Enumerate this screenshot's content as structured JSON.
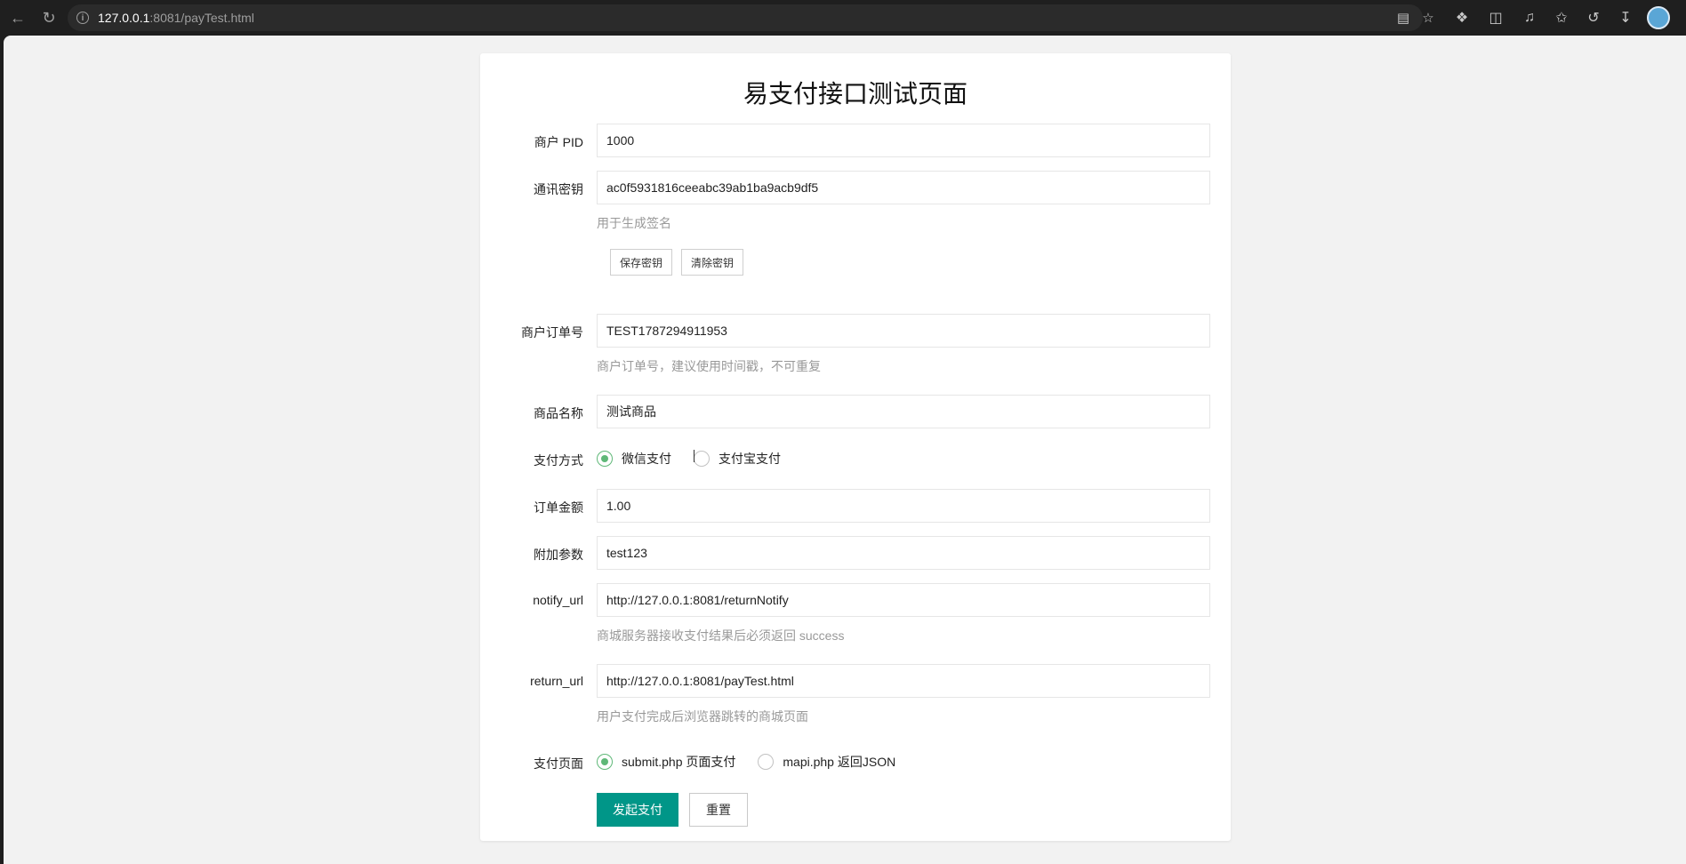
{
  "browser": {
    "url_host": "127.0.0.1",
    "url_rest": ":8081/payTest.html"
  },
  "page": {
    "title": "易支付接口测试页面",
    "fields": {
      "pid": {
        "label": "商户 PID",
        "value": "1000"
      },
      "key": {
        "label": "通讯密钥",
        "value": "ac0f5931816ceeabc39ab1ba9acb9df5",
        "hint": "用于生成签名"
      },
      "save_key_label": "保存密钥",
      "clear_key_label": "清除密钥",
      "out_trade_no": {
        "label": "商户订单号",
        "value": "TEST1787294911953",
        "hint": "商户订单号，建议使用时间戳，不可重复"
      },
      "name": {
        "label": "商品名称",
        "value": "测试商品"
      },
      "pay_type": {
        "label": "支付方式",
        "options": [
          {
            "label": "微信支付",
            "checked": true
          },
          {
            "label": "支付宝支付",
            "checked": false
          }
        ]
      },
      "money": {
        "label": "订单金额",
        "value": "1.00"
      },
      "param": {
        "label": "附加参数",
        "value": "test123"
      },
      "notify_url": {
        "label": "notify_url",
        "value": "http://127.0.0.1:8081/returnNotify",
        "hint": "商城服务器接收支付结果后必须返回 success"
      },
      "return_url": {
        "label": "return_url",
        "value": "http://127.0.0.1:8081/payTest.html",
        "hint": "用户支付完成后浏览器跳转的商城页面"
      },
      "pay_page": {
        "label": "支付页面",
        "options": [
          {
            "label": "submit.php 页面支付",
            "checked": true
          },
          {
            "label": "mapi.php 返回JSON",
            "checked": false
          }
        ]
      }
    },
    "submit_label": "发起支付",
    "reset_label": "重置"
  },
  "colors": {
    "primary": "#009688",
    "radio_checked": "#5fb878"
  }
}
